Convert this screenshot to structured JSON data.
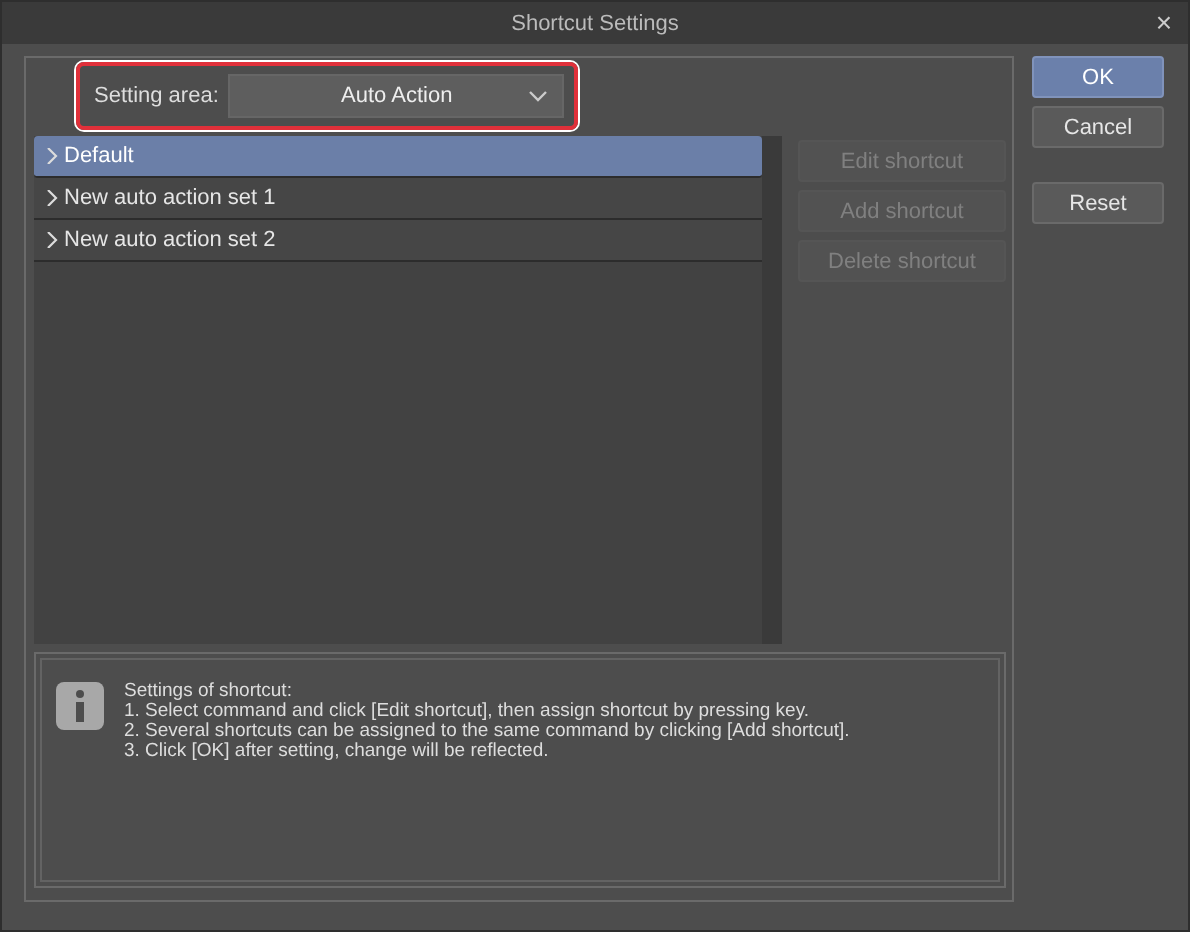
{
  "window": {
    "title": "Shortcut Settings",
    "close": "×"
  },
  "setting_area": {
    "label": "Setting area:",
    "value": "Auto Action",
    "highlighted": true
  },
  "sets": [
    {
      "label": "Default",
      "selected": true,
      "expanded": false
    },
    {
      "label": "New auto action set 1",
      "selected": false,
      "expanded": false
    },
    {
      "label": "New auto action set 2",
      "selected": false,
      "expanded": false
    }
  ],
  "shortcut_buttons": [
    {
      "label": "Edit shortcut",
      "disabled": true
    },
    {
      "label": "Add shortcut",
      "disabled": true
    },
    {
      "label": "Delete shortcut",
      "disabled": true
    }
  ],
  "dialog_buttons": [
    {
      "label": "OK",
      "default": true
    },
    {
      "label": "Cancel",
      "default": false
    },
    {
      "label": "Reset",
      "default": false
    }
  ],
  "info": {
    "title": "Settings of shortcut:",
    "lines": [
      "1. Select command and click [Edit shortcut], then assign shortcut by pressing key.",
      "2. Several shortcuts can be assigned to the same command by clicking [Add shortcut].",
      "3. Click [OK] after setting, change will be reflected."
    ]
  }
}
